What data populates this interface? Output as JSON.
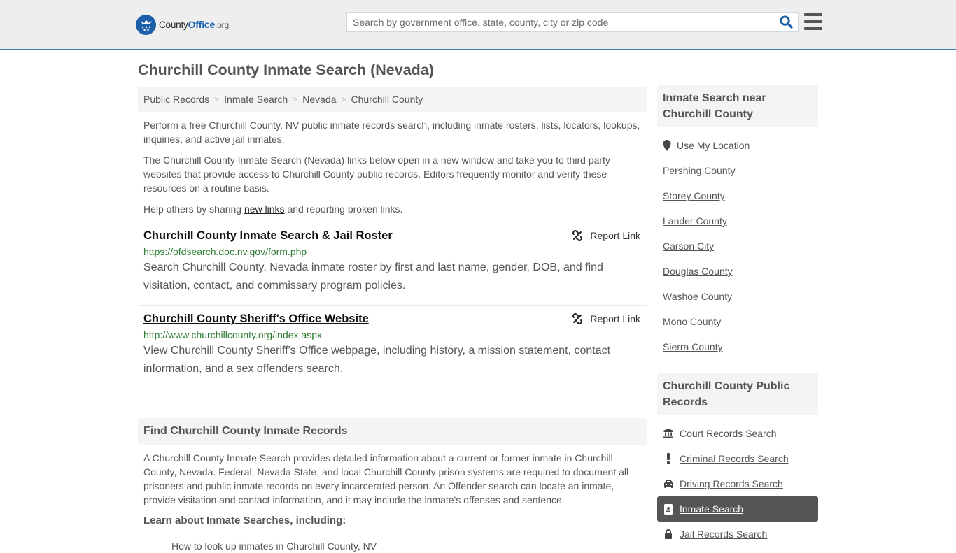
{
  "header": {
    "logo": {
      "name_part1": "County",
      "name_part2": "Office",
      "name_part3": ".org",
      "icon": "eagle-stars-badge-icon",
      "color": "#1b5fa8"
    },
    "search": {
      "placeholder": "Search by government office, state, county, city or zip code",
      "value": "",
      "icon": "search-icon"
    },
    "menu_icon": "hamburger-menu-icon",
    "accent_color": "#3f7ca8"
  },
  "page": {
    "title": "Churchill County Inmate Search (Nevada)"
  },
  "breadcrumb": [
    {
      "label": "Public Records"
    },
    {
      "label": "Inmate Search"
    },
    {
      "label": "Nevada"
    },
    {
      "label": "Churchill County"
    }
  ],
  "breadcrumb_separator": ">",
  "intro": {
    "p1": "Perform a free Churchill County, NV public inmate records search, including inmate rosters, lists, locators, lookups, inquiries, and active jail inmates.",
    "p2": "The Churchill County Inmate Search (Nevada) links below open in a new window and take you to third party websites that provide access to Churchill County public records. Editors frequently monitor and verify these resources on a routine basis.",
    "p3_before": "Help others by sharing ",
    "p3_link": "new links",
    "p3_after": " and reporting broken links."
  },
  "results": [
    {
      "title": "Churchill County Inmate Search & Jail Roster",
      "url": "https://ofdsearch.doc.nv.gov/form.php",
      "description": "Search Churchill County, Nevada inmate roster by first and last name, gender, DOB, and find visitation, contact, and commissary program policies.",
      "report_label": "Report Link"
    },
    {
      "title": "Churchill County Sheriff's Office Website",
      "url": "http://www.churchillcounty.org/index.aspx",
      "description": "View Churchill County Sheriff's Office webpage, including history, a mission statement, contact information, and a sex offenders search.",
      "report_label": "Report Link"
    }
  ],
  "find_section": {
    "heading": "Find Churchill County Inmate Records",
    "body": "A Churchill County Inmate Search provides detailed information about a current or former inmate in Churchill County, Nevada. Federal, Nevada State, and local Churchill County prison systems are required to document all prisoners and public inmate records on every incarcerated person. An Offender search can locate an inmate, provide visitation and contact information, and it may include the inmate's offenses and sentence.",
    "learn_heading": "Learn about Inmate Searches, including:",
    "clipped_item": "How to look up inmates in Churchill County, NV"
  },
  "sidebar": {
    "near": {
      "heading": "Inmate Search near Churchill County",
      "use_location": {
        "label": "Use My Location",
        "icon": "map-pin-icon"
      },
      "items": [
        {
          "label": "Pershing County"
        },
        {
          "label": "Storey County"
        },
        {
          "label": "Lander County"
        },
        {
          "label": "Carson City"
        },
        {
          "label": "Douglas County"
        },
        {
          "label": "Washoe County"
        },
        {
          "label": "Mono County"
        },
        {
          "label": "Sierra County"
        }
      ]
    },
    "records": {
      "heading": "Churchill County Public Records",
      "items": [
        {
          "label": "Court Records Search",
          "icon": "courthouse-icon",
          "active": false
        },
        {
          "label": "Criminal Records Search",
          "icon": "exclamation-icon",
          "active": false
        },
        {
          "label": "Driving Records Search",
          "icon": "car-icon",
          "active": false
        },
        {
          "label": "Inmate Search",
          "icon": "id-badge-icon",
          "active": true
        },
        {
          "label": "Jail Records Search",
          "icon": "lock-icon",
          "active": false
        }
      ]
    }
  }
}
